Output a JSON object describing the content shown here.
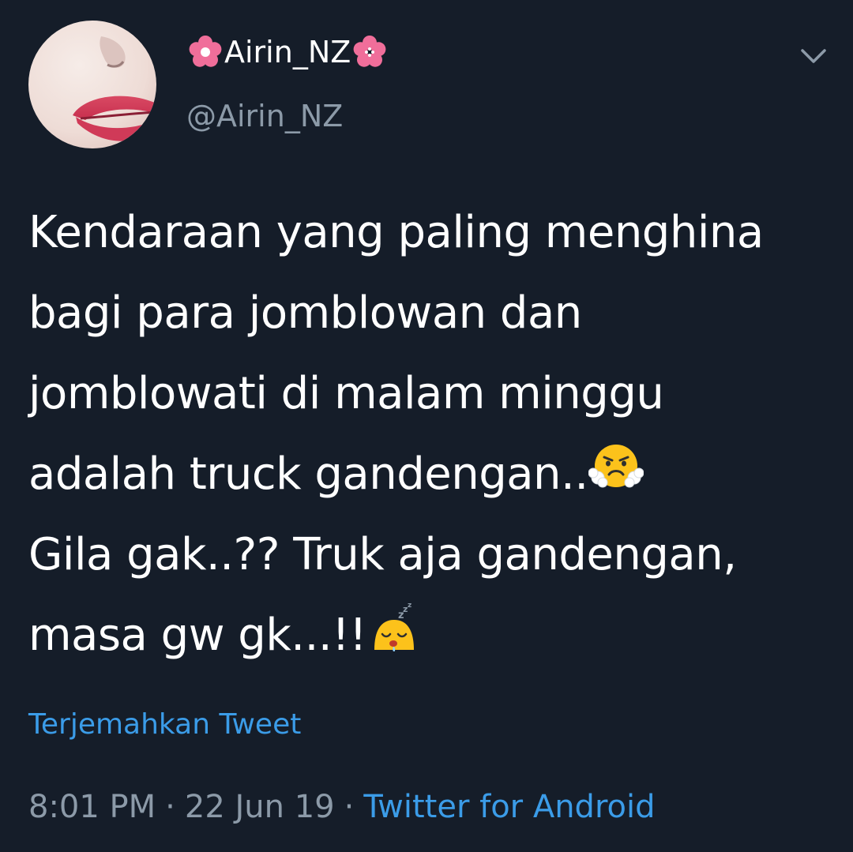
{
  "author": {
    "display_name": "Airin_NZ",
    "handle": "@Airin_NZ",
    "name_decoration_icon": "cherry-blossom-icon"
  },
  "menu": {
    "icon": "chevron-down-icon"
  },
  "tweet": {
    "lines": [
      "Kendaraan yang paling menghina",
      "bagi para jomblowan dan",
      "jomblowati di malam minggu",
      "adalah truck gandengan..",
      "Gila gak..?? Truk aja gandengan,",
      "masa gw gk...!!"
    ],
    "emojis": [
      "face-with-steam-icon",
      "sleepy-face-icon"
    ]
  },
  "translate_label": "Terjemahkan Tweet",
  "meta": {
    "time": "8:01 PM",
    "separator": "·",
    "date": "22 Jun 19",
    "source": "Twitter for Android"
  },
  "colors": {
    "background": "#151d29",
    "text": "#ffffff",
    "secondary_text": "#8c9aa8",
    "link": "#3b9ce8",
    "flower": "#f06e9a"
  }
}
